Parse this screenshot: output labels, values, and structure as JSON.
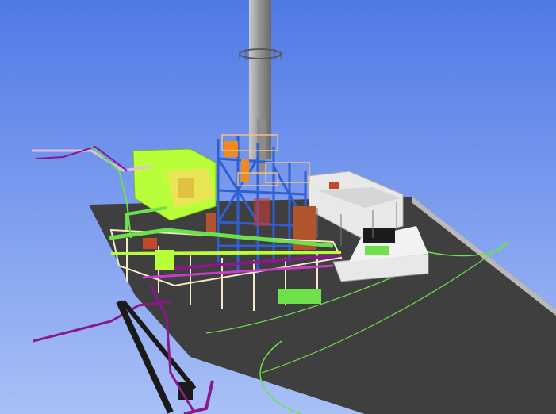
{
  "scene": {
    "colors": {
      "sky_top": "#4f79e6",
      "sky_bottom": "#a9c0f6",
      "ground": "#3f3f40",
      "ground_edge": "#b9b9b9",
      "pipe_green": "#6ee04a",
      "pipe_lime": "#b8ff3a",
      "pipe_purple": "#8a1a8c",
      "pipe_magenta": "#c83cc8",
      "steel_blue": "#2f5fd0",
      "steel_orange": "#f08a20",
      "stack_gray": "#9a9a9a",
      "building_white": "#e8e8e8",
      "rust": "#b0542e",
      "yellow": "#f2e05a"
    },
    "icons": [
      "stack",
      "boiler-structure",
      "pipe-rack",
      "building",
      "ground-slab",
      "ladder"
    ]
  }
}
